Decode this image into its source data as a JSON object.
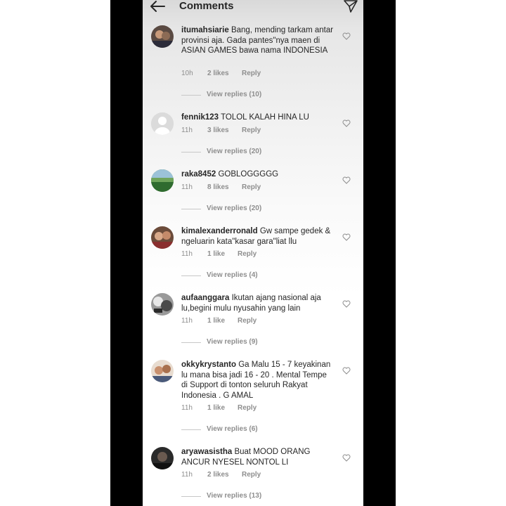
{
  "header": {
    "title": "Comments",
    "back_icon": "arrow-left-icon",
    "send_icon": "paper-plane-icon"
  },
  "comments": [
    {
      "username": "itumahsiarie",
      "text": "Bang, mending tarkam antar provinsi aja. Gada pantes\"nya maen di ASIAN GAMES bawa nama INDONESIA",
      "time": "10h",
      "likes": "2 likes",
      "reply": "Reply",
      "view_replies": "View replies (10)"
    },
    {
      "username": "fennik123",
      "text": "TOLOL KALAH HINA LU",
      "time": "11h",
      "likes": "3 likes",
      "reply": "Reply",
      "view_replies": "View replies (20)"
    },
    {
      "username": "raka8452",
      "text": "GOBLOGGGGG",
      "time": "11h",
      "likes": "8 likes",
      "reply": "Reply",
      "view_replies": "View replies (20)"
    },
    {
      "username": "kimalexanderronald",
      "text": "Gw sampe gedek & ngeluarin kata\"kasar gara\"liat llu",
      "time": "11h",
      "likes": "1 like",
      "reply": "Reply",
      "view_replies": "View replies (4)"
    },
    {
      "username": "aufaanggara",
      "text": "Ikutan ajang nasional aja lu,begini mulu nyusahin yang lain",
      "time": "11h",
      "likes": "1 like",
      "reply": "Reply",
      "view_replies": "View replies (9)"
    },
    {
      "username": "okkykrystanto",
      "text": "Ga Malu 15 - 7 keyakinan lu mana bisa jadi 16 - 20 . Mental Tempe di Support di tonton seluruh Rakyat Indonesia . G AMAL",
      "time": "11h",
      "likes": "1 like",
      "reply": "Reply",
      "view_replies": "View replies (6)"
    },
    {
      "username": "aryawasistha",
      "text": "Buat MOOD ORANG ANCUR NYESEL NONTOL LI",
      "time": "11h",
      "likes": "2 likes",
      "reply": "Reply",
      "view_replies": "View replies (13)"
    }
  ],
  "colors": {
    "text": "#262626",
    "secondary": "#8e8e8e",
    "background": "#ffffff",
    "frame": "#000000"
  }
}
